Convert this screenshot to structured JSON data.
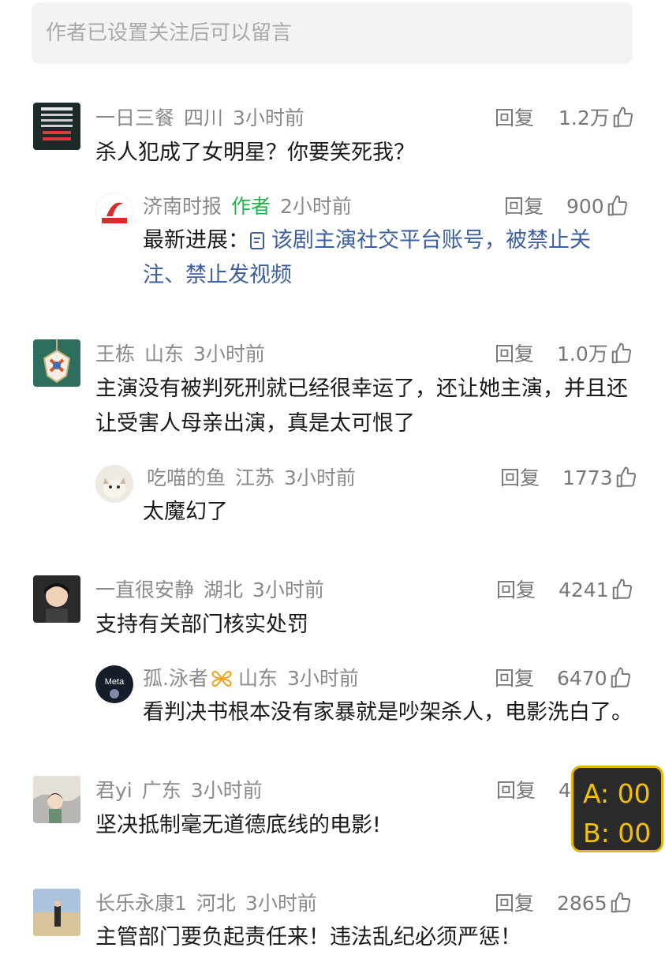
{
  "notice": "作者已设置关注后可以留言",
  "common": {
    "reply_label": "回复"
  },
  "comments": [
    {
      "user": "一日三餐",
      "location": "四川",
      "time": "3小时前",
      "likes": "1.2万",
      "text": "杀人犯成了女明星？你要笑死我？",
      "reply": {
        "user": "济南时报",
        "author_tag": "作者",
        "time": "2小时前",
        "likes": "900",
        "prefix": "最新进展：",
        "link_line1": "该剧主演社交平台账号，被禁止关",
        "link_line2": "注、禁止发视频"
      }
    },
    {
      "user": "王栋",
      "location": "山东",
      "time": "3小时前",
      "likes": "1.0万",
      "text_line1": "主演没有被判死刑就已经很幸运了，还让她主演，并且还",
      "text_line2": "让受害人母亲出演，真是太可恨了",
      "reply": {
        "user": "吃喵的鱼",
        "location": "江苏",
        "time": "3小时前",
        "likes": "1773",
        "text": "太魔幻了"
      }
    },
    {
      "user": "一直很安静",
      "location": "湖北",
      "time": "3小时前",
      "likes": "4241",
      "text": "支持有关部门核实处罚",
      "reply": {
        "user": "孤.泳者",
        "location": "山东",
        "time": "3小时前",
        "likes": "6470",
        "avatar_text": "Meta",
        "text": "看判决书根本没有家暴就是吵架杀人，电影洗白了。"
      }
    },
    {
      "user": "君yi",
      "location": "广东",
      "time": "3小时前",
      "likes": "4",
      "text": "坚决抵制毫无道德底线的电影!"
    },
    {
      "user": "长乐永康1",
      "location": "河北",
      "time": "3小时前",
      "likes": "2865",
      "text": "主管部门要负起责任来！违法乱纪必须严惩！"
    }
  ],
  "overlay": {
    "line_a": "A: 00",
    "line_b": "B: 00"
  },
  "colors": {
    "link": "#3d5f9e",
    "author_tag": "#22b14c",
    "overlay_text": "#f2c200",
    "overlay_border": "#e3b400"
  }
}
